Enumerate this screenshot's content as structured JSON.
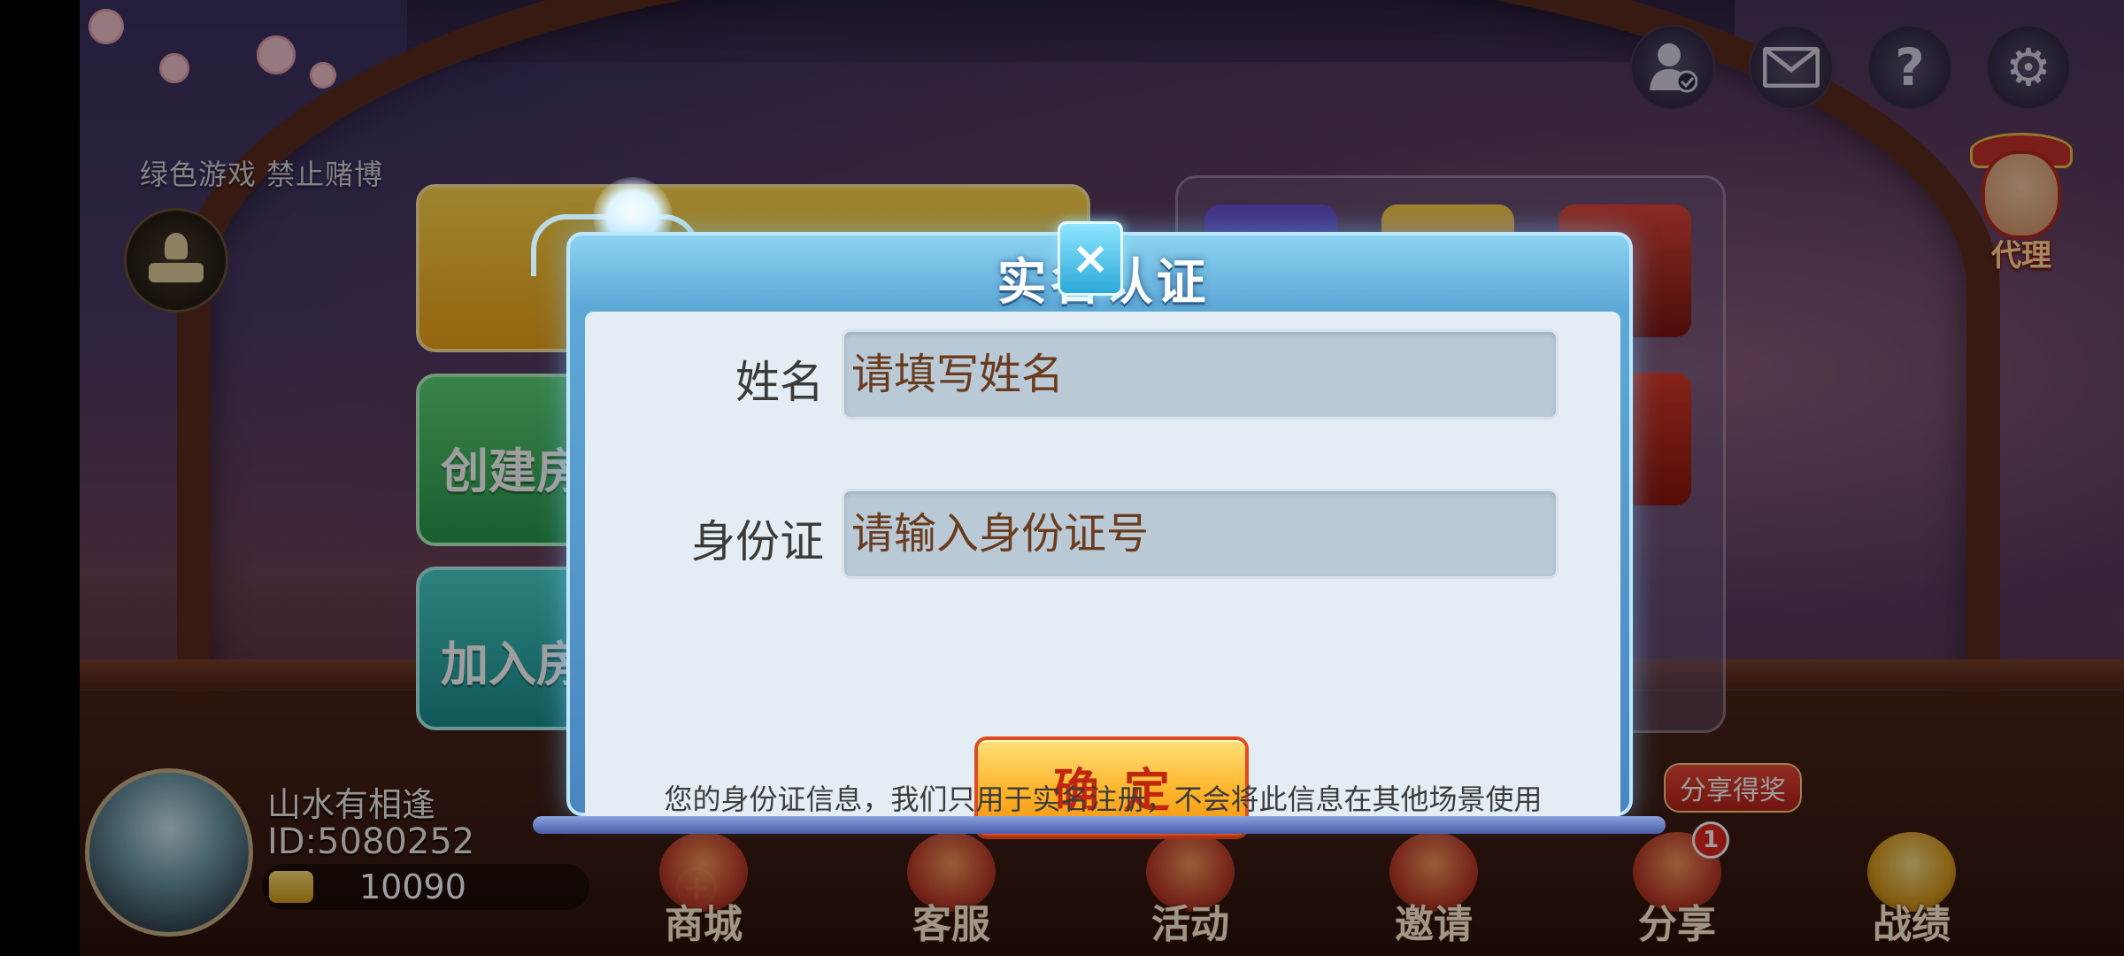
{
  "lobby": {
    "warning": "绿色游戏 禁止赌博",
    "top_icons": [
      "user-check-icon",
      "mail-icon",
      "help-icon",
      "gear-icon"
    ],
    "agent_label": "代理",
    "panels": {
      "create_room": "创建房",
      "join_room": "加入房"
    }
  },
  "profile": {
    "name": "山水有相逢",
    "id": "ID:5080252",
    "coins": "10090",
    "add_label": "+"
  },
  "dock": {
    "items": [
      "商城",
      "客服",
      "活动",
      "邀请",
      "分享",
      "战绩"
    ],
    "share_tag": "分享得奖",
    "share_badge": "1"
  },
  "dialog": {
    "title": "实名认证",
    "close_label": "×",
    "name_label": "姓名",
    "name_placeholder": "请填写姓名",
    "id_label": "身份证",
    "id_placeholder": "请输入身份证号",
    "confirm_label": "确定",
    "notice": "您的身份证信息，我们只用于实名注册，不会将此信息在其他场景使用"
  },
  "colors": {
    "dialog_frame": "#5ea9d8",
    "dialog_body": "#e3edf3",
    "input_bg": "#b9c9d5",
    "confirm_bg": "#ffb52a",
    "confirm_text": "#c0250f"
  }
}
